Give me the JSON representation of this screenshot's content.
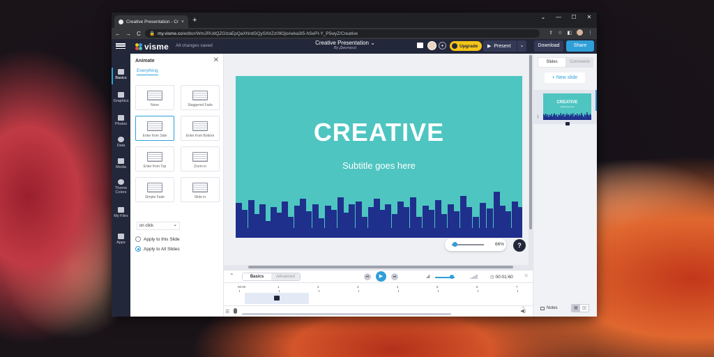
{
  "browser": {
    "tab_title": "Creative Presentation - Created u",
    "tab_close": "×",
    "new_tab": "+",
    "window_controls": [
      "⌄",
      "—",
      "☐",
      "✕"
    ],
    "nav": [
      "←",
      "→",
      "C"
    ],
    "lock": "🔒",
    "url_host": "my.visme.co",
    "url_path": "/editor/WmJRUdQZGlzaEpQaXNrdGQySXlrZz09OjoAeka3I5-hSePI-Y_P5wyZ/Creative",
    "right_icons": [
      "⇪",
      "☆",
      "◧",
      "⋮"
    ]
  },
  "app": {
    "logo_text": "visme",
    "saved_status": "All changes saved",
    "presentation_title": "Creative Presentation",
    "title_caret": "⌄",
    "author": "By Дмитрий",
    "plus": "+",
    "upgrade_label": "Upgrade",
    "present_label": "Present",
    "present_play": "▶",
    "present_dropdown": "⌄",
    "download_label": "Download",
    "share_label": "Share"
  },
  "rail": {
    "items": [
      "Basics",
      "Graphics",
      "Photos",
      "Data",
      "Media",
      "Theme Colors",
      "My Files",
      "Apps"
    ]
  },
  "animate_panel": {
    "title": "Animate",
    "close": "✕",
    "tab": "Everything",
    "options": [
      "None",
      "Staggered Fade",
      "Enter from Side",
      "Enter from Bottom",
      "Enter from Top",
      "Zoom in",
      "Simple Fade",
      "Slide in"
    ],
    "selected": "Enter from Side",
    "trigger": "on click",
    "radio_this": "Apply to this Slide",
    "radio_all": "Apply to All Slides",
    "radio_selected": "Apply to All Slides"
  },
  "slide": {
    "title": "CREATIVE",
    "subtitle": "Subtitle goes here",
    "bg_color": "#4ec5c1",
    "skyline_color": "#1f2f8c"
  },
  "zoom": {
    "value_label": "66%",
    "level": 0.07
  },
  "help": "?",
  "timeline": {
    "collapse": "⌃",
    "tab_basics": "Basics",
    "tab_advanced": "Advanced",
    "prev": "⏮",
    "play": "▶",
    "next": "⏭",
    "volume_icon": "◢",
    "time": "00:01:60",
    "close": "✕",
    "ruler": [
      "00:00",
      "1",
      "2",
      "3",
      "4",
      "5",
      "6",
      "7"
    ],
    "menu": "☰",
    "speaker": "◀)",
    "add": "+"
  },
  "right_panel": {
    "tab_slides": "Slides",
    "tab_comments": "Comments",
    "new_slide": "+ New slide",
    "slide_number": "1",
    "mini_title": "CREATIVE",
    "mini_sub": "Subtitle goes here",
    "notes_label": "Notes",
    "view_list": "▦",
    "view_grid": "▯▯"
  },
  "colors": {
    "accent": "#2f9fd8",
    "appbar": "#23273a",
    "upgrade": "#f5c518"
  }
}
